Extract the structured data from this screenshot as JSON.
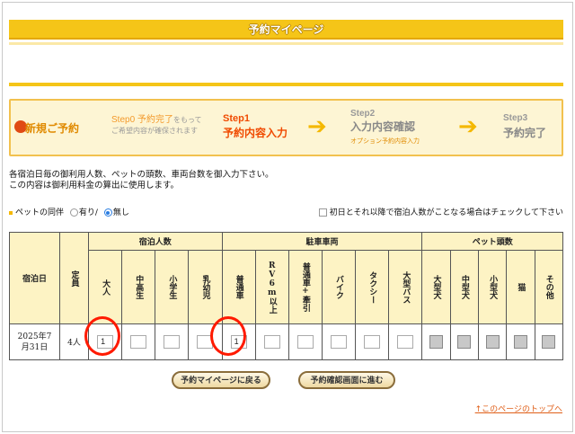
{
  "page": {
    "title": "予約マイページ"
  },
  "steps": {
    "new_reservation": "新規ご予約",
    "step0_label": "Step0 予約完了",
    "step0_suffix": "をもって",
    "step0_note": "ご希望内容が確保されます",
    "step1_label": "Step1",
    "step1_title": "予約内容入力",
    "step2_label": "Step2",
    "step2_title": "入力内容確認",
    "step2_sub": "オプション予約内容入力",
    "step3_label": "Step3",
    "step3_title": "予約完了"
  },
  "instructions": {
    "line1": "各宿泊日毎の御利用人数、ペットの頭数、車両台数を御入力下さい。",
    "line2": "この内容は御利用料金の算出に使用します。"
  },
  "pet": {
    "label": "ペットの同伴",
    "option_yes": "有り/",
    "option_no": "無し",
    "selected": "無し",
    "check_label": "初日とそれ以降で宿泊人数がことなる場合はチェックして下さい"
  },
  "table": {
    "col_date": "宿泊日",
    "col_capacity": "定員",
    "group_guests": "宿泊人数",
    "group_vehicles": "駐車車両",
    "group_pets": "ペット頭数",
    "guest_cols": [
      "大人",
      "中高生",
      "小学生",
      "乳幼児"
    ],
    "vehicle_cols": [
      "普通車",
      "RV6m以上",
      "普通車+牽引",
      "バイク",
      "タクシー",
      "大型バス"
    ],
    "pet_cols": [
      "大型犬",
      "中型犬",
      "小型犬",
      "猫",
      "その他"
    ],
    "row": {
      "date_line1": "2025年7",
      "date_line2": "月31日",
      "capacity": "4人",
      "adults": "1",
      "teen": "",
      "child": "",
      "infant": "",
      "car": "1",
      "rv": "",
      "tow": "",
      "bike": "",
      "taxi": "",
      "bus": ""
    }
  },
  "buttons": {
    "back": "予約マイページに戻る",
    "next": "予約確認画面に進む"
  },
  "links": {
    "top": "↑このページのトップへ"
  },
  "colors": {
    "accent": "#f5c518",
    "highlight": "#ff1a00",
    "link": "#e0601a"
  }
}
